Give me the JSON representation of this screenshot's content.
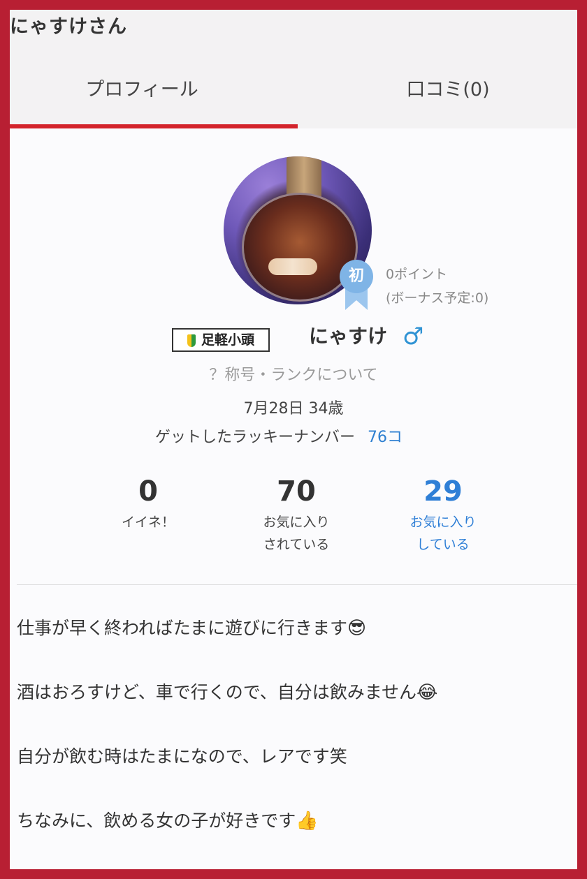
{
  "header": {
    "title": "にゃすけさん",
    "tabs": [
      {
        "label": "プロフィール",
        "active": true
      },
      {
        "label": "口コミ(0)",
        "active": false
      }
    ]
  },
  "colors": {
    "frame": "#b81f33",
    "tab_indicator": "#d3232b",
    "link_blue": "#2f80d1",
    "badge_blue": "#7fb4e6"
  },
  "profile": {
    "beginner_badge": "初",
    "points": "0ポイント",
    "bonus": "(ボーナス予定:0)",
    "rank_title": "足軽小頭",
    "username": "にゃすけ",
    "gender_symbol": "♂",
    "rank_link": "？称号・ランクについて",
    "birthday_age": "7月28日 34歳",
    "lucky_label": "ゲットしたラッキーナンバー",
    "lucky_count": "76コ"
  },
  "stats": [
    {
      "value": "0",
      "label_line1": "イイネ！",
      "label_line2": ""
    },
    {
      "value": "70",
      "label_line1": "お気に入り",
      "label_line2": "されている"
    },
    {
      "value": "29",
      "label_line1": "お気に入り",
      "label_line2": "している"
    }
  ],
  "bio": [
    {
      "text": "仕事が早く終わればたまに遊びに行きます",
      "emoji": "😎",
      "emoji_name": "sunglasses-emoji"
    },
    {
      "text": "酒はおろすけど、車で行くので、自分は飲みません",
      "emoji": "😂",
      "emoji_name": "tears-of-joy-emoji"
    },
    {
      "text": "自分が飲む時はたまになので、レアです笑",
      "emoji": "",
      "emoji_name": ""
    },
    {
      "text": "ちなみに、飲める女の子が好きです",
      "emoji": "👍",
      "emoji_name": "thumbs-up-emoji"
    }
  ]
}
